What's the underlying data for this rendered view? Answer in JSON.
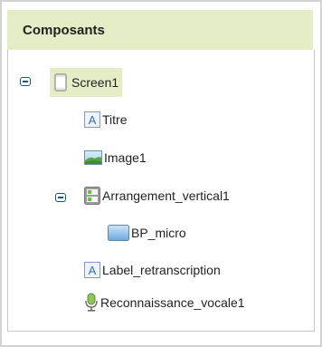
{
  "panel": {
    "title": "Composants"
  },
  "tree": {
    "root": {
      "label": "Screen1",
      "icon": "screen-icon",
      "expanded": true,
      "selected": true
    },
    "nodes": [
      {
        "label": "Titre",
        "icon": "label-icon"
      },
      {
        "label": "Image1",
        "icon": "image-icon"
      },
      {
        "label": "Arrangement_vertical1",
        "icon": "vertical-arrangement-icon",
        "expanded": true
      },
      {
        "label": "BP_micro",
        "icon": "button-icon"
      },
      {
        "label": "Label_retranscription",
        "icon": "label-icon"
      },
      {
        "label": "Reconnaissance_vocale1",
        "icon": "speech-recognizer-icon"
      }
    ]
  },
  "colors": {
    "header_bg": "#e4edc6",
    "selected_bg": "#e4edc6",
    "toggle": "#1d5577",
    "border": "#d3d3d3"
  }
}
